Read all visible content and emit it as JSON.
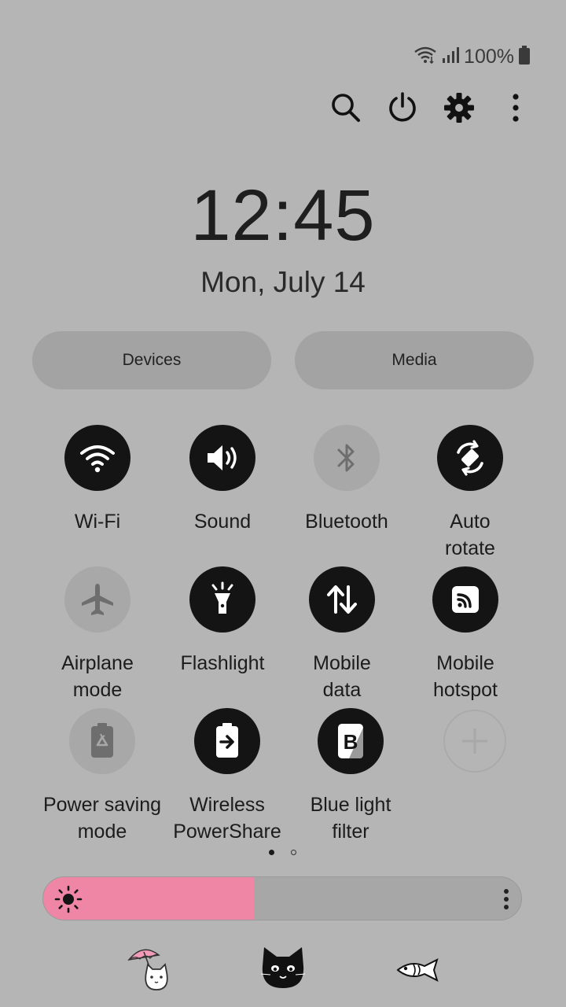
{
  "status_bar": {
    "battery_percent_label": "100%",
    "battery_level": 1.0
  },
  "top_icons": [
    "search-icon",
    "power-icon",
    "gear-icon",
    "more-vert-icon"
  ],
  "clock": {
    "time": "12:45",
    "date": "Mon, July 14"
  },
  "buttons": {
    "devices": "Devices",
    "media": "Media"
  },
  "tiles": [
    {
      "label": "Wi-Fi",
      "icon": "wifi-icon",
      "state": "on"
    },
    {
      "label": "Sound",
      "icon": "sound-icon",
      "state": "on"
    },
    {
      "label": "Bluetooth",
      "icon": "bluetooth-icon",
      "state": "off"
    },
    {
      "label": "Auto\nrotate",
      "icon": "auto-rotate-icon",
      "state": "on"
    },
    {
      "label": "Airplane\nmode",
      "icon": "airplane-icon",
      "state": "off"
    },
    {
      "label": "Flashlight",
      "icon": "flashlight-icon",
      "state": "on"
    },
    {
      "label": "Mobile\ndata",
      "icon": "mobile-data-icon",
      "state": "on"
    },
    {
      "label": "Mobile\nhotspot",
      "icon": "hotspot-icon",
      "state": "on"
    },
    {
      "label": "Power saving\nmode",
      "icon": "power-saving-icon",
      "state": "off"
    },
    {
      "label": "Wireless\nPowerShare",
      "icon": "wireless-powershare-icon",
      "state": "on"
    },
    {
      "label": "Blue light\nfilter",
      "icon": "blue-light-filter-icon",
      "state": "on"
    },
    {
      "label": "",
      "icon": "add-icon",
      "state": "empty"
    }
  ],
  "pages": {
    "count": 2,
    "current": 1
  },
  "brightness": {
    "level": 0.44,
    "fill_color": "#ef86a6"
  },
  "decorations": [
    "cat-umbrella-icon",
    "black-cat-icon",
    "fish-icon"
  ]
}
